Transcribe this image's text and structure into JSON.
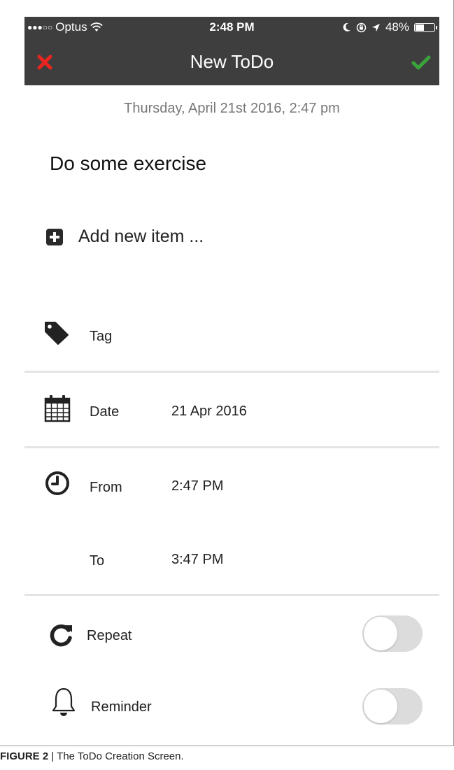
{
  "status_bar": {
    "signal_dots": "●●●○○",
    "carrier": "Optus",
    "wifi_icon": "wifi-icon",
    "time": "2:48 PM",
    "battery_percent": "48%",
    "battery_level": 0.48
  },
  "nav": {
    "title": "New ToDo",
    "cancel_color": "#e8261f",
    "done_color": "#3aa33a"
  },
  "todo": {
    "created_at": "Thursday, April 21st 2016, 2:47 pm",
    "title": "Do some exercise",
    "add_item_label": "Add new item ..."
  },
  "fields": {
    "tag_label": "Tag",
    "date_label": "Date",
    "date_value": "21 Apr 2016",
    "from_label": "From",
    "from_value": "2:47 PM",
    "to_label": "To",
    "to_value": "3:47 PM",
    "repeat_label": "Repeat",
    "repeat_on": false,
    "reminder_label": "Reminder",
    "reminder_on": false
  },
  "caption": {
    "label": "FIGURE 2",
    "separator": " | ",
    "text": "The ToDo Creation Screen."
  }
}
